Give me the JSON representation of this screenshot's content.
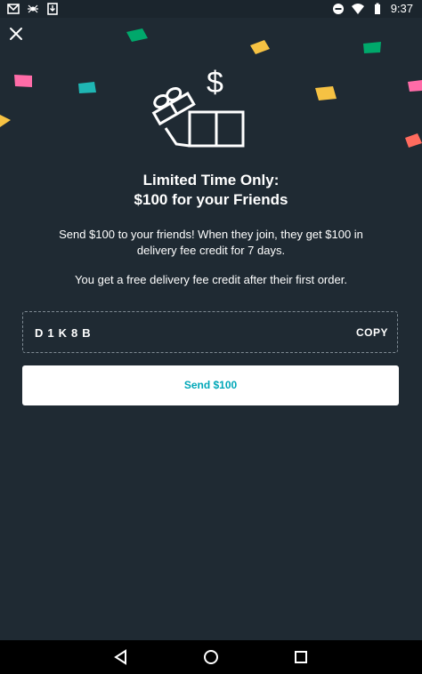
{
  "status_bar": {
    "time": "9:37",
    "left_icons": [
      "gmail-icon",
      "spider-icon",
      "download-icon"
    ],
    "right_icons": [
      "do-not-disturb-icon",
      "wifi-icon",
      "battery-icon"
    ]
  },
  "header": {
    "close_icon": "close-icon"
  },
  "promo": {
    "title_line1": "Limited Time Only:",
    "title_line2": "$100 for your Friends",
    "description_line1": "Send $100 to your friends! When they join, they get $100 in",
    "description_line2": "delivery fee credit for 7 days.",
    "sub_text": "You get a free delivery fee credit after their first order.",
    "illustration_icon": "gift-dollar-icon"
  },
  "referral": {
    "code": "D1K8B",
    "copy_label": "COPY"
  },
  "actions": {
    "send_label": "Send $100"
  },
  "navigation": {
    "back_icon": "back-icon",
    "home_icon": "home-icon",
    "recents_icon": "recents-icon"
  },
  "colors": {
    "background": "#1f2a33",
    "accent": "#00a7b8",
    "confetti": [
      "#00a86b",
      "#f6c243",
      "#ff6ca8",
      "#1fb6b4",
      "#ff6b5e"
    ]
  }
}
